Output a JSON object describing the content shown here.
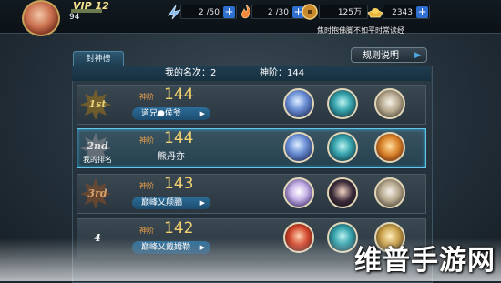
{
  "player": {
    "vip": "VIP 12",
    "level": "94"
  },
  "resources": [
    {
      "name": "stamina",
      "icon": "stamina-icon",
      "value": "2 /50"
    },
    {
      "name": "energy",
      "icon": "energy-icon",
      "value": "2 /30"
    },
    {
      "name": "coins",
      "icon": "coin-icon",
      "value": "125万"
    },
    {
      "name": "ingots",
      "icon": "ingot-icon",
      "value": "2343"
    }
  ],
  "notice": "焦时抱佛脚不如平时常读经",
  "tab_label": "封神榜",
  "rules_button": "规则说明",
  "summary": {
    "my_rank": "我的名次：2",
    "my_level": "神阶：144"
  },
  "rank_label": "神阶",
  "my_rank_tag": "我的排名",
  "rows": [
    {
      "rank": "1st",
      "value": "144",
      "name": "道兄●侯爷",
      "has_button": true,
      "is_me": false,
      "rank_color": "#e8d27a",
      "heroes": [
        "hero-blue-bird",
        "hero-teal-warrior",
        "hero-silver-warrior"
      ]
    },
    {
      "rank": "2nd",
      "value": "144",
      "name": "熊丹亦",
      "has_button": false,
      "is_me": true,
      "rank_color": "#e0e0e0",
      "heroes": [
        "hero-blue-bird",
        "hero-teal-warrior",
        "hero-monkey-king"
      ]
    },
    {
      "rank": "3rd",
      "value": "143",
      "name": "巅峰乂颠鵬",
      "has_button": true,
      "is_me": false,
      "rank_color": "#d9a06a",
      "heroes": [
        "hero-white-fox",
        "hero-dark-lady",
        "hero-silver-warrior"
      ]
    },
    {
      "rank": "4",
      "value": "142",
      "name": "巅峰乂戴姆勒",
      "has_button": true,
      "is_me": false,
      "rank_color": "#ffffff",
      "heroes": [
        "hero-red-warrior",
        "hero-teal-warrior",
        "hero-gold-general"
      ]
    }
  ],
  "watermark": "维普手游网",
  "colors": {
    "accent_blue": "#2f6fd0",
    "gold": "#f3d170",
    "rank_orange": "#f0a24a",
    "highlight": "#66c6e9"
  }
}
